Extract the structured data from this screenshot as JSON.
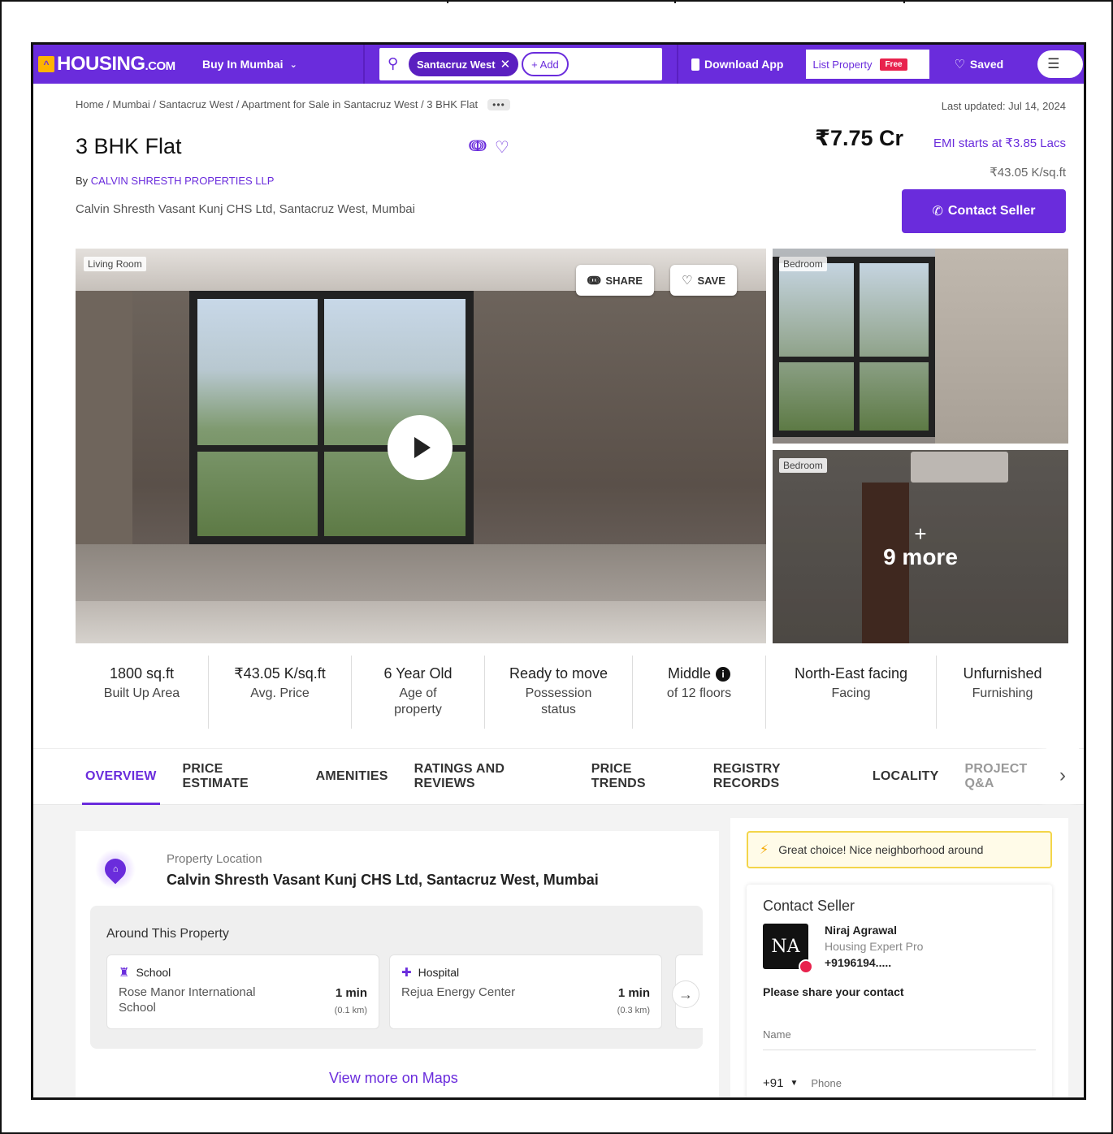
{
  "header": {
    "logo_text": "HOUSING",
    "logo_suffix": ".COM",
    "buy_in": "Buy In Mumbai",
    "search_chip": "Santacruz West",
    "add_chip": "+ Add",
    "download_app": "Download App",
    "list_property": "List Property",
    "free_badge": "Free",
    "saved": "Saved"
  },
  "breadcrumb": "Home / Mumbai / Santacruz West / Apartment for Sale in Santacruz West / 3 BHK Flat",
  "breadcrumb_more": "•••",
  "last_updated": "Last updated: Jul 14, 2024",
  "listing": {
    "title": "3 BHK Flat",
    "by_prefix": "By ",
    "developer": "CALVIN SHRESTH PROPERTIES LLP",
    "address": "Calvin Shresth Vasant Kunj CHS Ltd, Santacruz West, Mumbai",
    "price": "₹7.75 Cr",
    "emi": "EMI starts at ₹3.85 Lacs",
    "price_per_sqft": "₹43.05 K/sq.ft",
    "contact_button": "Contact Seller"
  },
  "photos": {
    "main_tag": "Living Room",
    "share": "SHARE",
    "save": "SAVE",
    "side1_tag": "Bedroom",
    "side2_tag": "Bedroom",
    "more_plus": "+",
    "more_text": "9 more"
  },
  "stats": [
    {
      "value": "1800 sq.ft",
      "label": "Built Up Area"
    },
    {
      "value": "₹43.05 K/sq.ft",
      "label": "Avg. Price"
    },
    {
      "value": "6 Year Old",
      "label": "Age of property"
    },
    {
      "value": "Ready to move",
      "label": "Possession status"
    },
    {
      "value": "Middle",
      "label": "of 12 floors"
    },
    {
      "value": "North-East facing",
      "label": "Facing"
    },
    {
      "value": "Unfurnished",
      "label": "Furnishing"
    }
  ],
  "tabs": [
    "OVERVIEW",
    "PRICE ESTIMATE",
    "AMENITIES",
    "RATINGS AND REVIEWS",
    "PRICE TRENDS",
    "REGISTRY RECORDS",
    "LOCALITY",
    "PROJECT Q&A"
  ],
  "location": {
    "label": "Property Location",
    "address": "Calvin Shresth Vasant Kunj CHS Ltd, Santacruz West, Mumbai",
    "around_title": "Around This Property",
    "pois": [
      {
        "type": "School",
        "name": "Rose Manor International School",
        "time": "1 min",
        "distance": "(0.1 km)"
      },
      {
        "type": "Hospital",
        "name": "Rejua Energy Center",
        "time": "1 min",
        "distance": "(0.3 km)"
      }
    ],
    "view_maps": "View more on Maps"
  },
  "sidebar": {
    "great_choice": "Great choice! Nice neighborhood around",
    "contact_title": "Contact Seller",
    "avatar_initials": "NA",
    "seller_name": "Niraj Agrawal",
    "seller_role": "Housing Expert Pro",
    "seller_phone": "+9196194.....",
    "share_contact": "Please share your contact",
    "name_placeholder": "Name",
    "country_code": "+91",
    "phone_placeholder": "Phone"
  },
  "colors": {
    "brand": "#6a2cdc",
    "accent_yellow": "#ffb400",
    "badge_red": "#e8224d"
  }
}
